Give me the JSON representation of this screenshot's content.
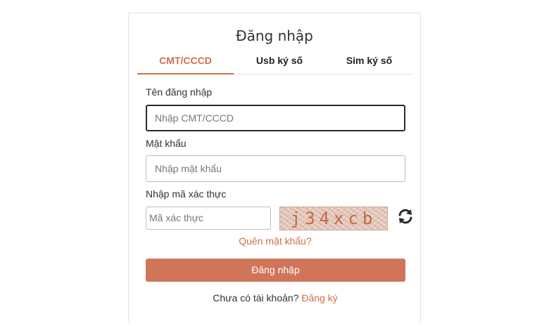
{
  "form": {
    "title": "Đăng nhập",
    "tabs": [
      {
        "label": "CMT/CCCD",
        "active": true
      },
      {
        "label": "Usb ký số",
        "active": false
      },
      {
        "label": "Sim ký số",
        "active": false
      }
    ],
    "username": {
      "label": "Tên đăng nhập",
      "placeholder": "Nhập CMT/CCCD",
      "value": ""
    },
    "password": {
      "label": "Mật khẩu",
      "placeholder": "Nhập mật khẩu",
      "value": ""
    },
    "captcha": {
      "label": "Nhập mã xác thực",
      "placeholder": "Mã xác thực",
      "code": "j34xcb",
      "refresh_icon": "refresh-icon"
    },
    "forgot_password": "Quên mật khẩu?",
    "submit_label": "Đăng nhập",
    "register_prompt": "Chưa có tài khoản?",
    "register_link": "Đăng ký"
  },
  "colors": {
    "accent": "#cf6f4b",
    "button": "#d0755a",
    "captcha_bg": "#e2c5b7"
  }
}
